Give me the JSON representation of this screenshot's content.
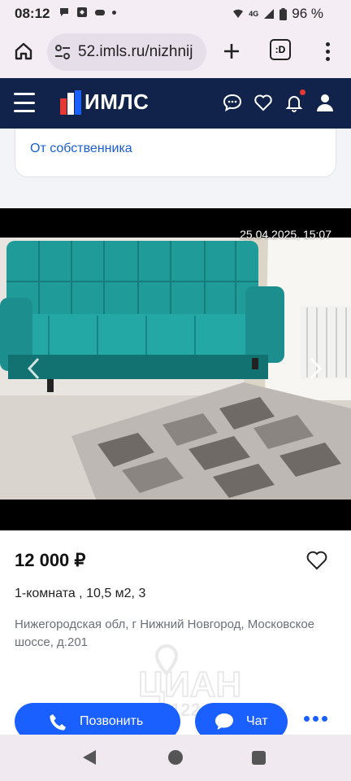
{
  "status_bar": {
    "time": "08:12",
    "network": "4G",
    "battery": "96 %"
  },
  "browser": {
    "url": "52.imls.ru/nizhnij",
    "tabs_label": ":D"
  },
  "site": {
    "logo_text": "ИМЛС"
  },
  "listing": {
    "seller_type": "От собственника",
    "photo_date": "25.04.2025, 15:07",
    "price": "12 000 ₽",
    "title": "1-комната , 10,5 м2, 3",
    "address": "Нижегородская обл, г Нижний Новгород, Московское шоссе, д.201",
    "watermark_text": "ЦИАН",
    "watermark_number": "1224875"
  },
  "actions": {
    "call_label": "Позвонить",
    "chat_label": "Чат"
  },
  "colors": {
    "accent": "#1a5fff",
    "header_bg": "#11234a",
    "link": "#1a5fd1"
  }
}
